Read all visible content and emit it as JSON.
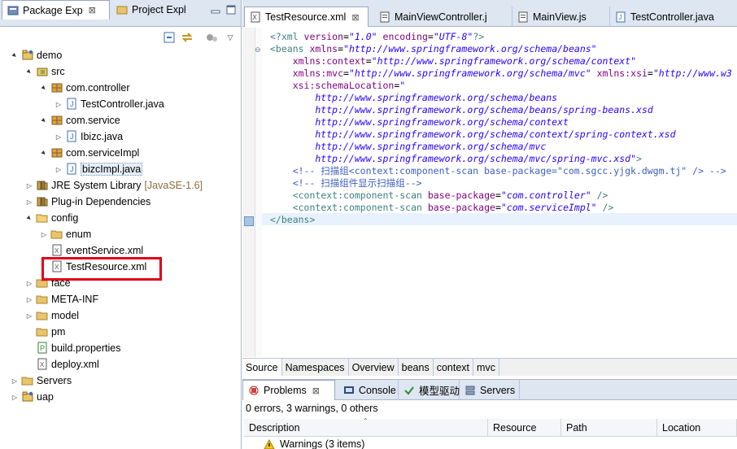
{
  "explorer": {
    "tabs": [
      {
        "label": "Package Exp",
        "close": "⊠"
      },
      {
        "label": "Project Expl"
      }
    ],
    "tree": [
      {
        "label": "demo",
        "depth": 0,
        "arrow": "▲",
        "icon": "project-icon"
      },
      {
        "label": "src",
        "depth": 1,
        "arrow": "▲",
        "icon": "source-folder-icon"
      },
      {
        "label": "com.controller",
        "depth": 2,
        "arrow": "▲",
        "icon": "package-icon"
      },
      {
        "label": "TestController.java",
        "depth": 3,
        "arrow": "▷",
        "icon": "java-file-icon"
      },
      {
        "label": "com.service",
        "depth": 2,
        "arrow": "▲",
        "icon": "package-icon"
      },
      {
        "label": "Ibizc.java",
        "depth": 3,
        "arrow": "▷",
        "icon": "java-file-icon"
      },
      {
        "label": "com.serviceImpl",
        "depth": 2,
        "arrow": "▲",
        "icon": "package-icon"
      },
      {
        "label": "bizcImpl.java",
        "depth": 3,
        "arrow": "▷",
        "icon": "java-file-icon",
        "selected": true
      },
      {
        "label": "JRE System Library",
        "decoration": "[JavaSE-1.6]",
        "depth": 1,
        "arrow": "▷",
        "icon": "library-icon"
      },
      {
        "label": "Plug-in Dependencies",
        "depth": 1,
        "arrow": "▷",
        "icon": "library-icon"
      },
      {
        "label": "config",
        "depth": 1,
        "arrow": "▲",
        "icon": "folder-open-icon"
      },
      {
        "label": "enum",
        "depth": 2,
        "arrow": "▷",
        "icon": "folder-icon"
      },
      {
        "label": "eventService.xml",
        "depth": 2,
        "arrow": "",
        "icon": "xml-file-icon"
      },
      {
        "label": "TestResource.xml",
        "depth": 2,
        "arrow": "",
        "icon": "xml-file-icon"
      },
      {
        "label": "face",
        "depth": 1,
        "arrow": "▷",
        "icon": "folder-icon"
      },
      {
        "label": "META-INF",
        "depth": 1,
        "arrow": "▷",
        "icon": "folder-icon"
      },
      {
        "label": "model",
        "depth": 1,
        "arrow": "▷",
        "icon": "folder-icon"
      },
      {
        "label": "pm",
        "depth": 1,
        "arrow": "",
        "icon": "folder-icon"
      },
      {
        "label": "build.properties",
        "depth": 1,
        "arrow": "",
        "icon": "properties-file-icon"
      },
      {
        "label": "deploy.xml",
        "depth": 1,
        "arrow": "",
        "icon": "xml-file-icon"
      },
      {
        "label": "Servers",
        "depth": 0,
        "arrow": "▷",
        "icon": "folder-icon"
      },
      {
        "label": "uap",
        "depth": 0,
        "arrow": "▷",
        "icon": "project-icon"
      }
    ]
  },
  "editor": {
    "tabs": [
      {
        "label": "TestResource.xml",
        "close": "⊠",
        "active": true
      },
      {
        "label": "MainViewController.j"
      },
      {
        "label": "MainView.js"
      },
      {
        "label": "TestController.java"
      }
    ],
    "code": [
      [
        {
          "c": "c-pi",
          "t": "<?xml "
        },
        {
          "c": "c-attr",
          "t": "version"
        },
        {
          "c": "c-txt",
          "t": "="
        },
        {
          "c": "c-val",
          "t": "\"1.0\""
        },
        {
          "c": "c-txt",
          "t": " "
        },
        {
          "c": "c-attr",
          "t": "encoding"
        },
        {
          "c": "c-txt",
          "t": "="
        },
        {
          "c": "c-val",
          "t": "\"UTF-8\""
        },
        {
          "c": "c-pi",
          "t": "?>"
        }
      ],
      [
        {
          "c": "c-tag",
          "t": "<beans "
        },
        {
          "c": "c-attr",
          "t": "xmlns"
        },
        {
          "c": "c-txt",
          "t": "="
        },
        {
          "c": "c-val",
          "t": "\"http://www.springframework.org/schema/beans\""
        }
      ],
      [
        {
          "c": "c-txt",
          "t": "    "
        },
        {
          "c": "c-attr",
          "t": "xmlns:context"
        },
        {
          "c": "c-txt",
          "t": "="
        },
        {
          "c": "c-val",
          "t": "\"http://www.springframework.org/schema/context\""
        }
      ],
      [
        {
          "c": "c-txt",
          "t": "    "
        },
        {
          "c": "c-attr",
          "t": "xmlns:mvc"
        },
        {
          "c": "c-txt",
          "t": "="
        },
        {
          "c": "c-val",
          "t": "\"http://www.springframework.org/schema/mvc\""
        },
        {
          "c": "c-txt",
          "t": " "
        },
        {
          "c": "c-attr",
          "t": "xmlns:xsi"
        },
        {
          "c": "c-txt",
          "t": "="
        },
        {
          "c": "c-val",
          "t": "\"http://www.w3"
        }
      ],
      [
        {
          "c": "c-txt",
          "t": "    "
        },
        {
          "c": "c-attr",
          "t": "xsi:schemaLocation"
        },
        {
          "c": "c-txt",
          "t": "="
        },
        {
          "c": "c-val",
          "t": "\""
        }
      ],
      [
        {
          "c": "c-val",
          "t": "        http://www.springframework.org/schema/beans"
        }
      ],
      [
        {
          "c": "c-val",
          "t": "        http://www.springframework.org/schema/beans/spring-beans.xsd"
        }
      ],
      [
        {
          "c": "c-val",
          "t": "        http://www.springframework.org/schema/context"
        }
      ],
      [
        {
          "c": "c-val",
          "t": "        http://www.springframework.org/schema/context/spring-context.xsd"
        }
      ],
      [
        {
          "c": "c-val",
          "t": "        http://www.springframework.org/schema/mvc"
        }
      ],
      [
        {
          "c": "c-val",
          "t": "        http://www.springframework.org/schema/mvc/spring-mvc.xsd\""
        },
        {
          "c": "c-tag",
          "t": ">"
        }
      ],
      [
        {
          "c": "c-cmt",
          "t": "    <!-- 扫描组<context:component-scan base-package=\"com.sgcc.yjgk.dwgm.tj\" /> -->"
        }
      ],
      [
        {
          "c": "c-cmt",
          "t": "    <!-- 扫描组件显示扫描组-->"
        }
      ],
      [
        {
          "c": "c-txt",
          "t": "    "
        },
        {
          "c": "c-tag",
          "t": "<context:component-scan "
        },
        {
          "c": "c-attr",
          "t": "base-package"
        },
        {
          "c": "c-txt",
          "t": "="
        },
        {
          "c": "c-val",
          "t": "\"com.controller\""
        },
        {
          "c": "c-txt",
          "t": " "
        },
        {
          "c": "c-tag",
          "t": "/>"
        }
      ],
      [
        {
          "c": "c-txt",
          "t": "    "
        },
        {
          "c": "c-tag",
          "t": "<context:component-scan "
        },
        {
          "c": "c-attr",
          "t": "base-package"
        },
        {
          "c": "c-txt",
          "t": "="
        },
        {
          "c": "c-val",
          "t": "\"com.serviceImpl\""
        },
        {
          "c": "c-txt",
          "t": " "
        },
        {
          "c": "c-tag",
          "t": "/>"
        }
      ],
      [
        {
          "c": "c-tag",
          "t": "</beans>"
        }
      ]
    ],
    "bottom_tabs": [
      "Source",
      "Namespaces",
      "Overview",
      "beans",
      "context",
      "mvc"
    ]
  },
  "problems": {
    "tabs": [
      {
        "label": "Problems",
        "close": "⊠",
        "active": true
      },
      {
        "label": "Console"
      },
      {
        "label": "模型驱动"
      },
      {
        "label": "Servers"
      }
    ],
    "summary": "0 errors, 3 warnings, 0 others",
    "columns": [
      "Description",
      "Resource",
      "Path",
      "Location"
    ],
    "rows": [
      {
        "label": "Warnings (3 items)"
      }
    ]
  },
  "colors": {
    "highlight_box": "#e0001a",
    "tab_strip": "#dde6f1"
  }
}
